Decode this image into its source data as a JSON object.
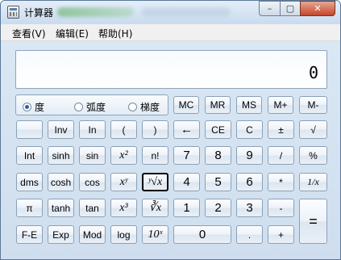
{
  "titlebar": {
    "title": "计算器",
    "min_glyph": "–",
    "max_glyph": "▢",
    "close_glyph": "✕"
  },
  "menubar": {
    "items": [
      "查看(V)",
      "编辑(E)",
      "帮助(H)"
    ]
  },
  "display": {
    "value": "0"
  },
  "angle_modes": [
    {
      "label": "度",
      "selected": true
    },
    {
      "label": "弧度",
      "selected": false
    },
    {
      "label": "梯度",
      "selected": false
    }
  ],
  "memory_row": [
    "MC",
    "MR",
    "MS",
    "M+",
    "M-"
  ],
  "keys": {
    "r1": [
      "",
      "Inv",
      "In",
      "(",
      ")",
      "←",
      "CE",
      "C",
      "±",
      "√"
    ],
    "r2": [
      "Int",
      "sinh",
      "sin",
      "x²",
      "n!",
      "7",
      "8",
      "9",
      "/",
      "%"
    ],
    "r3": [
      "dms",
      "cosh",
      "cos",
      "xʸ",
      "ʸ√x",
      "4",
      "5",
      "6",
      "*",
      "1/x"
    ],
    "r4": [
      "π",
      "tanh",
      "tan",
      "x³",
      "∛x",
      "1",
      "2",
      "3",
      "-",
      "="
    ],
    "r5": [
      "F-E",
      "Exp",
      "Mod",
      "log",
      "10ˣ",
      "0",
      ".",
      "+"
    ]
  },
  "colors": {
    "window_bg": "#d6e3f1",
    "key_border": "#8ba1b7",
    "selected_key_border": "#000000"
  }
}
